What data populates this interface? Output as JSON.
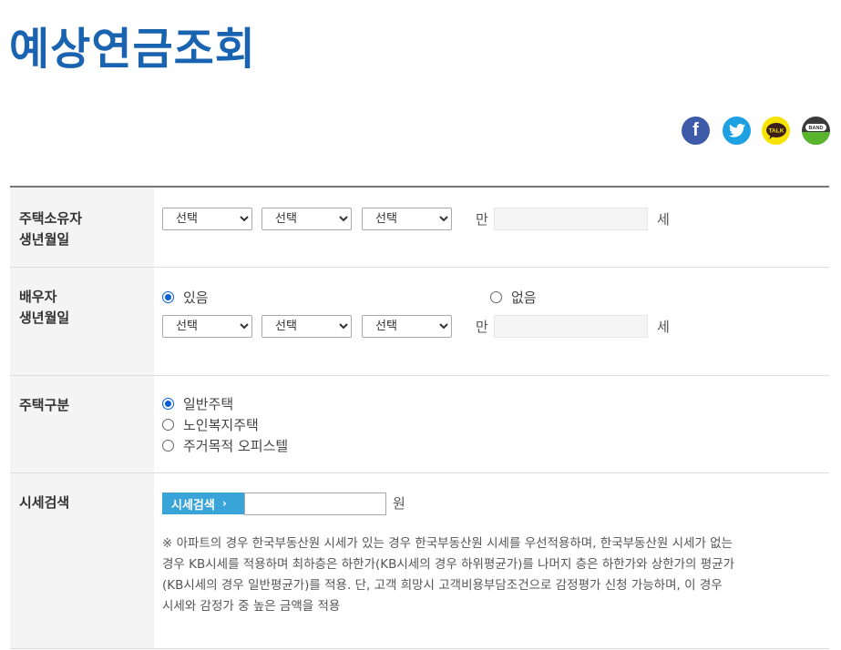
{
  "page": {
    "title": "예상연금조회"
  },
  "share": {
    "facebook": {
      "glyph": "f",
      "icon": "facebook-icon",
      "color": "#3d5ba9"
    },
    "twitter": {
      "icon": "twitter-icon",
      "color": "#1da1e2"
    },
    "kakaotalk": {
      "text": "TALK",
      "icon": "kakaotalk-icon",
      "color": "#f7e300"
    },
    "band": {
      "text": "BAND",
      "icon": "band-icon",
      "color": "#3a3a3a"
    }
  },
  "owner": {
    "label_line1": "주택소유자",
    "label_line2": "생년월일",
    "year": "선택",
    "month": "선택",
    "day": "선택",
    "age_prefix": "만",
    "age_value": "",
    "age_suffix": "세"
  },
  "spouse": {
    "label_line1": "배우자",
    "label_line2": "생년월일",
    "option_yes": "있음",
    "option_no": "없음",
    "selected": "있음",
    "year": "선택",
    "month": "선택",
    "day": "선택",
    "age_prefix": "만",
    "age_value": "",
    "age_suffix": "세"
  },
  "house_type": {
    "label": "주택구분",
    "options": [
      "일반주택",
      "노인복지주택",
      "주거목적 오피스텔"
    ],
    "selected": "일반주택"
  },
  "price_search": {
    "label": "시세검색",
    "button_label": "시세검색",
    "input_value": "",
    "unit": "원",
    "note_lines": [
      "※ 아파트의 경우 한국부동산원 시세가 있는 경우 한국부동산원 시세를 우선적용하며, 한국부동산원 시세가 없는",
      "경우 KB시세를 적용하며 최하층은 하한가(KB시세의 경우 하위평균가)를 나머지 층은 하한가와 상한가의 평균가",
      "(KB시세의 경우 일반평균가)를 적용. 단, 고객 희망시 고객비용부담조건으로 감정평가 신청 가능하며, 이 경우",
      "시세와 감정가 중 높은 금액을 적용"
    ]
  },
  "colors": {
    "title": "#1a63b0",
    "accent_button": "#39a4d8",
    "radio_selected": "#0b5fd6"
  }
}
